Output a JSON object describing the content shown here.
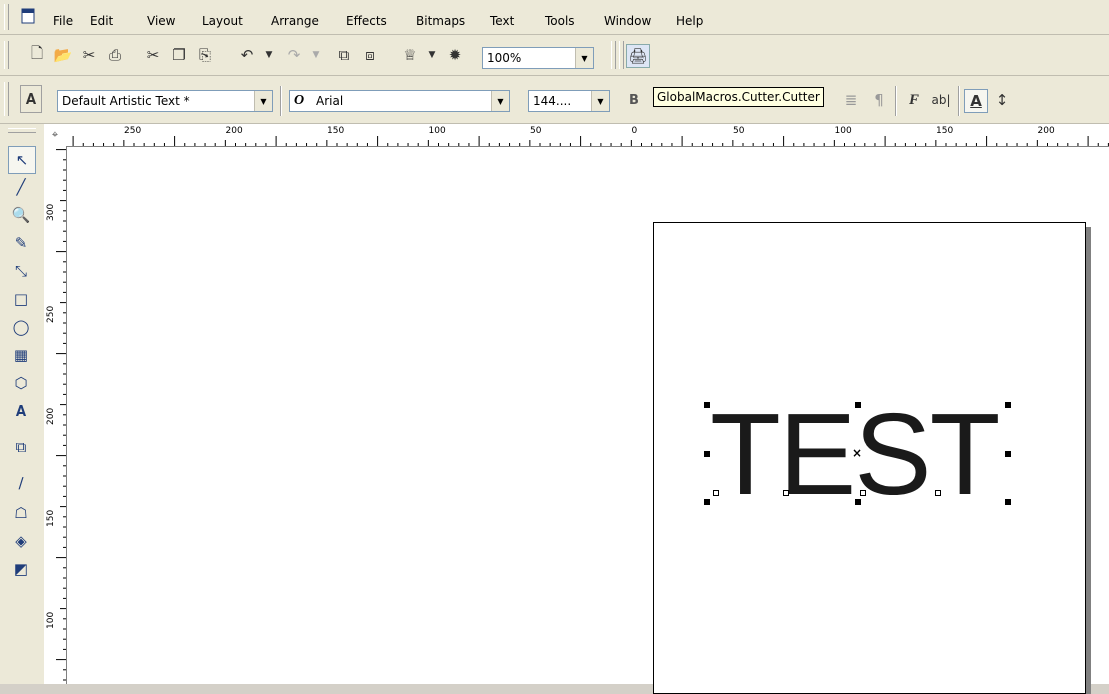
{
  "menu": {
    "items": [
      {
        "label": "File"
      },
      {
        "label": "Edit"
      },
      {
        "label": "View"
      },
      {
        "label": "Layout"
      },
      {
        "label": "Arrange"
      },
      {
        "label": "Effects"
      },
      {
        "label": "Bitmaps"
      },
      {
        "label": "Text"
      },
      {
        "label": "Tools"
      },
      {
        "label": "Window"
      },
      {
        "label": "Help"
      }
    ]
  },
  "toolbar": {
    "zoom_value": "100%"
  },
  "property_bar": {
    "text_style": "Default Artistic Text *",
    "font_name": "Arial",
    "font_size": "144....",
    "tooltip": "GlobalMacros.Cutter.Cutter"
  },
  "rulers": {
    "horizontal_labels": [
      "250",
      "200",
      "150",
      "100",
      "50",
      "0",
      "50",
      "100",
      "150",
      "200"
    ],
    "vertical_labels": [
      "300",
      "250",
      "200",
      "150",
      "100"
    ]
  },
  "canvas": {
    "artistic_text": "TEST"
  },
  "colors": {
    "chrome": "#ece9d8",
    "tooltip_bg": "#ffffe1",
    "page_shadow": "#808080"
  }
}
